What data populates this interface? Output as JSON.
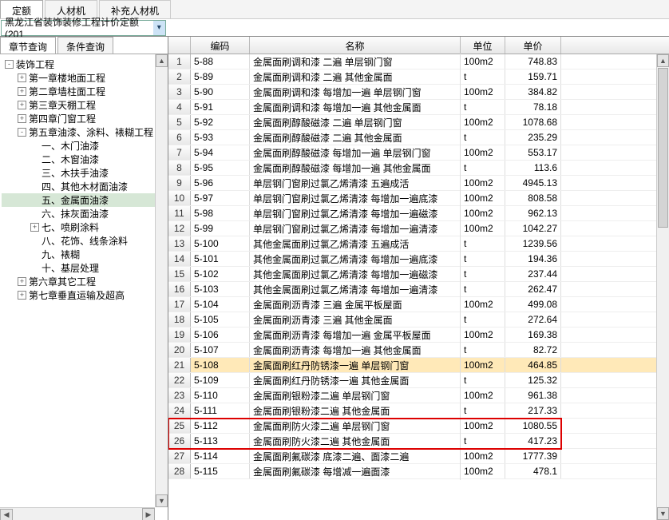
{
  "tabs": {
    "main": [
      "定额",
      "人材机",
      "补充人材机"
    ],
    "active": 0
  },
  "combo": {
    "text": "黑龙江省装饰装修工程计价定额(201"
  },
  "inner_tabs": {
    "items": [
      "章节查询",
      "条件查询"
    ],
    "active": 0
  },
  "tree": [
    {
      "lvl": 0,
      "exp": "-",
      "label": "装饰工程"
    },
    {
      "lvl": 1,
      "exp": "+",
      "label": "第一章楼地面工程"
    },
    {
      "lvl": 1,
      "exp": "+",
      "label": "第二章墙柱面工程"
    },
    {
      "lvl": 1,
      "exp": "+",
      "label": "第三章天棚工程"
    },
    {
      "lvl": 1,
      "exp": "+",
      "label": "第四章门窗工程"
    },
    {
      "lvl": 1,
      "exp": "-",
      "label": "第五章油漆、涂料、裱糊工程"
    },
    {
      "lvl": 2,
      "exp": "",
      "label": "一、木门油漆"
    },
    {
      "lvl": 2,
      "exp": "",
      "label": "二、木窗油漆"
    },
    {
      "lvl": 2,
      "exp": "",
      "label": "三、木扶手油漆"
    },
    {
      "lvl": 2,
      "exp": "",
      "label": "四、其他木材面油漆"
    },
    {
      "lvl": 2,
      "exp": "",
      "label": "五、金属面油漆",
      "selected": true
    },
    {
      "lvl": 2,
      "exp": "",
      "label": "六、抹灰面油漆"
    },
    {
      "lvl": 2,
      "exp": "+",
      "label": "七、喷刷涂料"
    },
    {
      "lvl": 2,
      "exp": "",
      "label": "八、花饰、线条涂料"
    },
    {
      "lvl": 2,
      "exp": "",
      "label": "九、裱糊"
    },
    {
      "lvl": 2,
      "exp": "",
      "label": "十、基层处理"
    },
    {
      "lvl": 1,
      "exp": "+",
      "label": "第六章其它工程"
    },
    {
      "lvl": 1,
      "exp": "+",
      "label": "第七章垂直运输及超高"
    }
  ],
  "grid": {
    "headers": {
      "num": "",
      "code": "编码",
      "name": "名称",
      "unit": "单位",
      "price": "单价"
    },
    "rows": [
      {
        "n": 1,
        "code": "5-88",
        "name": "金属面刷调和漆 二遍 单层钢门窗",
        "unit": "100m2",
        "price": "748.83"
      },
      {
        "n": 2,
        "code": "5-89",
        "name": "金属面刷调和漆 二遍 其他金属面",
        "unit": "t",
        "price": "159.71"
      },
      {
        "n": 3,
        "code": "5-90",
        "name": "金属面刷调和漆 每增加一遍 单层钢门窗",
        "unit": "100m2",
        "price": "384.82"
      },
      {
        "n": 4,
        "code": "5-91",
        "name": "金属面刷调和漆 每增加一遍 其他金属面",
        "unit": "t",
        "price": "78.18"
      },
      {
        "n": 5,
        "code": "5-92",
        "name": "金属面刷醇酸磁漆 二遍 单层钢门窗",
        "unit": "100m2",
        "price": "1078.68"
      },
      {
        "n": 6,
        "code": "5-93",
        "name": "金属面刷醇酸磁漆 二遍 其他金属面",
        "unit": "t",
        "price": "235.29"
      },
      {
        "n": 7,
        "code": "5-94",
        "name": "金属面刷醇酸磁漆 每增加一遍 单层钢门窗",
        "unit": "100m2",
        "price": "553.17"
      },
      {
        "n": 8,
        "code": "5-95",
        "name": "金属面刷醇酸磁漆 每增加一遍 其他金属面",
        "unit": "t",
        "price": "113.6"
      },
      {
        "n": 9,
        "code": "5-96",
        "name": "单层钢门窗刷过氯乙烯清漆 五遍成活",
        "unit": "100m2",
        "price": "4945.13"
      },
      {
        "n": 10,
        "code": "5-97",
        "name": "单层钢门窗刷过氯乙烯清漆 每增加一遍底漆",
        "unit": "100m2",
        "price": "808.58"
      },
      {
        "n": 11,
        "code": "5-98",
        "name": "单层钢门窗刷过氯乙烯清漆 每增加一遍磁漆",
        "unit": "100m2",
        "price": "962.13"
      },
      {
        "n": 12,
        "code": "5-99",
        "name": "单层钢门窗刷过氯乙烯清漆 每增加一遍清漆",
        "unit": "100m2",
        "price": "1042.27"
      },
      {
        "n": 13,
        "code": "5-100",
        "name": "其他金属面刷过氯乙烯清漆 五遍成活",
        "unit": "t",
        "price": "1239.56"
      },
      {
        "n": 14,
        "code": "5-101",
        "name": "其他金属面刷过氯乙烯清漆 每增加一遍底漆",
        "unit": "t",
        "price": "194.36"
      },
      {
        "n": 15,
        "code": "5-102",
        "name": "其他金属面刷过氯乙烯清漆 每增加一遍磁漆",
        "unit": "t",
        "price": "237.44"
      },
      {
        "n": 16,
        "code": "5-103",
        "name": "其他金属面刷过氯乙烯清漆 每增加一遍清漆",
        "unit": "t",
        "price": "262.47"
      },
      {
        "n": 17,
        "code": "5-104",
        "name": "金属面刷沥青漆 三遍 金属平板屋面",
        "unit": "100m2",
        "price": "499.08"
      },
      {
        "n": 18,
        "code": "5-105",
        "name": "金属面刷沥青漆 三遍 其他金属面",
        "unit": "t",
        "price": "272.64"
      },
      {
        "n": 19,
        "code": "5-106",
        "name": "金属面刷沥青漆 每增加一遍 金属平板屋面",
        "unit": "100m2",
        "price": "169.38"
      },
      {
        "n": 20,
        "code": "5-107",
        "name": "金属面刷沥青漆 每增加一遍 其他金属面",
        "unit": "t",
        "price": "82.72"
      },
      {
        "n": 21,
        "code": "5-108",
        "name": "金属面刷红丹防锈漆一遍 单层钢门窗",
        "unit": "100m2",
        "price": "464.85",
        "sel": true
      },
      {
        "n": 22,
        "code": "5-109",
        "name": "金属面刷红丹防锈漆一遍 其他金属面",
        "unit": "t",
        "price": "125.32"
      },
      {
        "n": 23,
        "code": "5-110",
        "name": "金属面刷银粉漆二遍 单层钢门窗",
        "unit": "100m2",
        "price": "961.38"
      },
      {
        "n": 24,
        "code": "5-111",
        "name": "金属面刷银粉漆二遍 其他金属面",
        "unit": "t",
        "price": "217.33"
      },
      {
        "n": 25,
        "code": "5-112",
        "name": "金属面刷防火漆二遍 单层钢门窗",
        "unit": "100m2",
        "price": "1080.55"
      },
      {
        "n": 26,
        "code": "5-113",
        "name": "金属面刷防火漆二遍 其他金属面",
        "unit": "t",
        "price": "417.23"
      },
      {
        "n": 27,
        "code": "5-114",
        "name": "金属面刷氟碳漆 底漆二遍、面漆二遍",
        "unit": "100m2",
        "price": "1777.39"
      },
      {
        "n": 28,
        "code": "5-115",
        "name": "金属面刷氟碳漆 每增减一遍面漆",
        "unit": "100m2",
        "price": "478.1"
      }
    ],
    "redbox_rows": [
      25,
      26
    ]
  }
}
